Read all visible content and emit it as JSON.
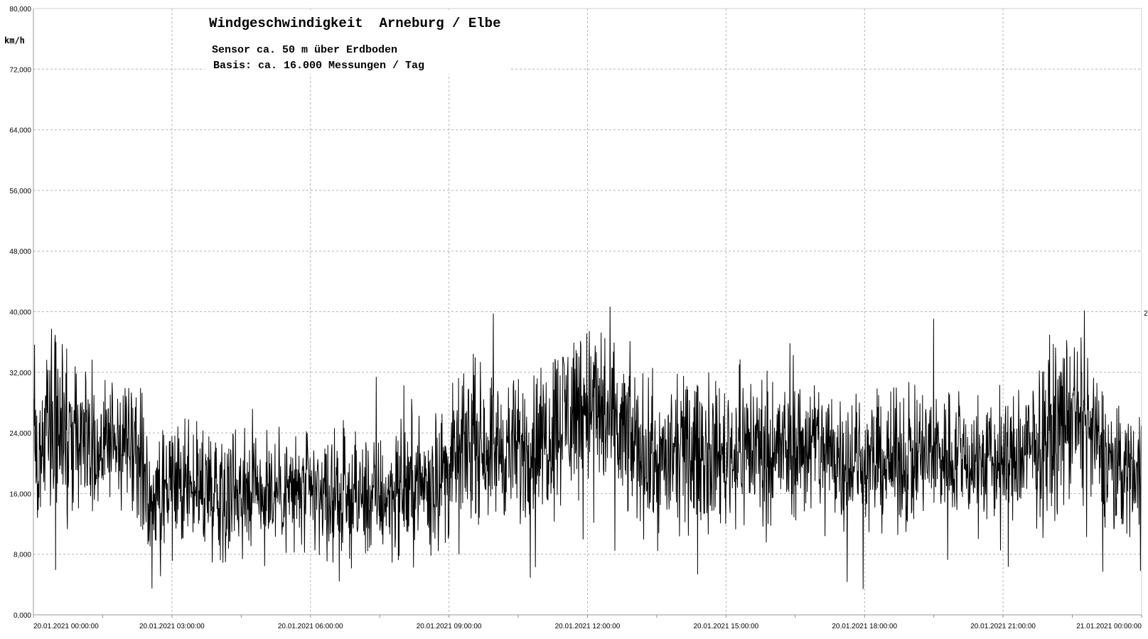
{
  "chart_data": {
    "type": "line",
    "title": "Windgeschwindigkeit  Arneburg / Elbe",
    "subtitle_lines": [
      "Sensor ca. 50 m über Erdboden",
      "Basis: ca. 16.000 Messungen / Tag"
    ],
    "xlabel": "",
    "ylabel": "km/h",
    "ylim": [
      0,
      80000
    ],
    "y_ticks": [
      "0,000",
      "8,000",
      "16,000",
      "24,000",
      "32,000",
      "40,000",
      "48,000",
      "56,000",
      "64,000",
      "72,000",
      "80,000"
    ],
    "x_ticks": [
      "20.01.2021  00:00:00",
      "20.01.2021  03:00:00",
      "20.01.2021  06:00:00",
      "20.01.2021  09:00:00",
      "20.01.2021  12:00:00",
      "20.01.2021  15:00:00",
      "20.01.2021  18:00:00",
      "20.01.2021  21:00:00",
      "21.01.2021  00:00:00"
    ],
    "x_range_hours": [
      0,
      24
    ],
    "right_edge_label": "2",
    "grid": true,
    "legend": "none",
    "series": [
      {
        "hours": [
          0,
          0.5,
          1,
          1.5,
          2,
          2.3,
          2.5,
          3,
          3.5,
          4,
          4.5,
          5,
          5.5,
          6,
          6.5,
          7,
          7.5,
          8,
          8.5,
          9,
          9.5,
          10,
          10.5,
          11,
          11.5,
          12,
          12.5,
          13,
          13.5,
          14,
          14.5,
          15,
          15.5,
          16,
          16.5,
          17,
          17.5,
          18,
          18.5,
          19,
          19.5,
          20,
          20.5,
          21,
          21.5,
          22,
          22.5,
          23,
          23.5,
          24
        ],
        "values": [
          23000,
          24000,
          24500,
          22000,
          22500,
          21500,
          14000,
          16500,
          17000,
          16500,
          17500,
          17000,
          16500,
          16000,
          15500,
          15500,
          15500,
          16500,
          17500,
          19000,
          23500,
          22000,
          21500,
          23000,
          26500,
          28500,
          25000,
          22500,
          19500,
          21000,
          21500,
          21000,
          22500,
          21500,
          22000,
          22500,
          21000,
          20000,
          20000,
          20500,
          21500,
          21000,
          20000,
          20000,
          21000,
          23500,
          26500,
          22500,
          19000,
          19500
        ],
        "variability": [
          5000,
          5500,
          6000,
          4500,
          4000,
          4000,
          4000,
          4000,
          4000,
          4000,
          4200,
          4000,
          4000,
          3800,
          3800,
          3800,
          3800,
          4000,
          4000,
          4500,
          4500,
          4500,
          4500,
          5000,
          5500,
          5500,
          5500,
          5000,
          4500,
          4500,
          4500,
          4500,
          5000,
          4500,
          4500,
          4500,
          4500,
          4000,
          4000,
          4500,
          4500,
          4000,
          4000,
          4000,
          4500,
          5000,
          5500,
          4500,
          4000,
          4000
        ]
      }
    ]
  }
}
